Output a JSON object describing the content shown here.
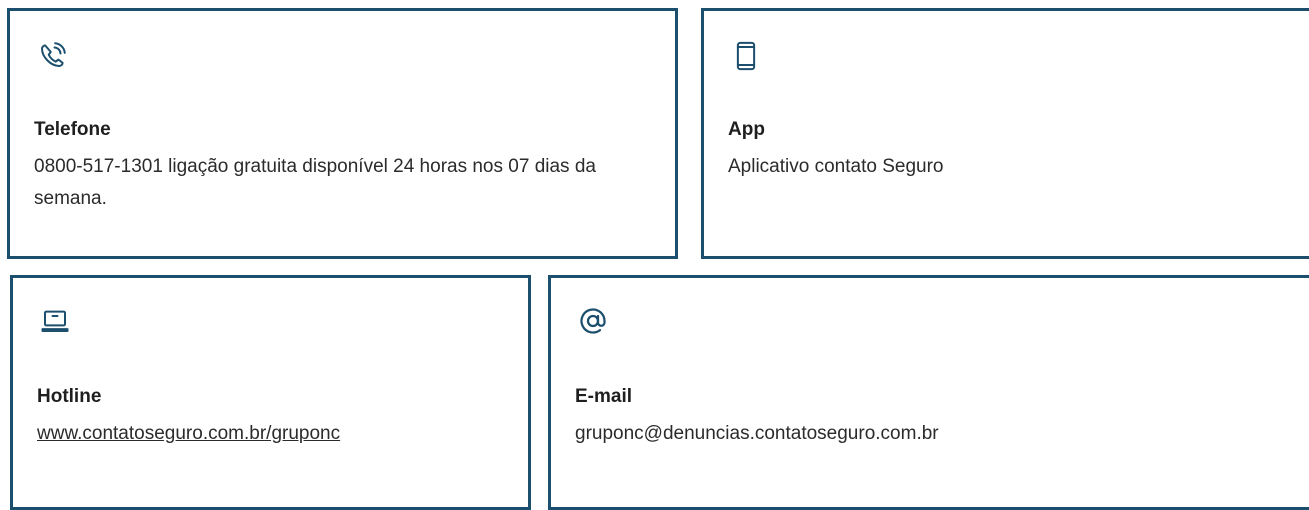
{
  "accent_color": "#1c4f6e",
  "cards": {
    "phone": {
      "icon": "phone-icon",
      "title": "Telefone",
      "description": "0800-517-1301 ligação gratuita disponível 24 horas nos 07 dias da semana."
    },
    "app": {
      "icon": "mobile-icon",
      "title": "App",
      "description": "Aplicativo contato Seguro"
    },
    "hotline": {
      "icon": "laptop-icon",
      "title": "Hotline",
      "link": "www.contatoseguro.com.br/gruponc"
    },
    "email": {
      "icon": "at-sign-icon",
      "title": "E-mail",
      "address": "gruponc@denuncias.contatoseguro.com.br"
    }
  }
}
